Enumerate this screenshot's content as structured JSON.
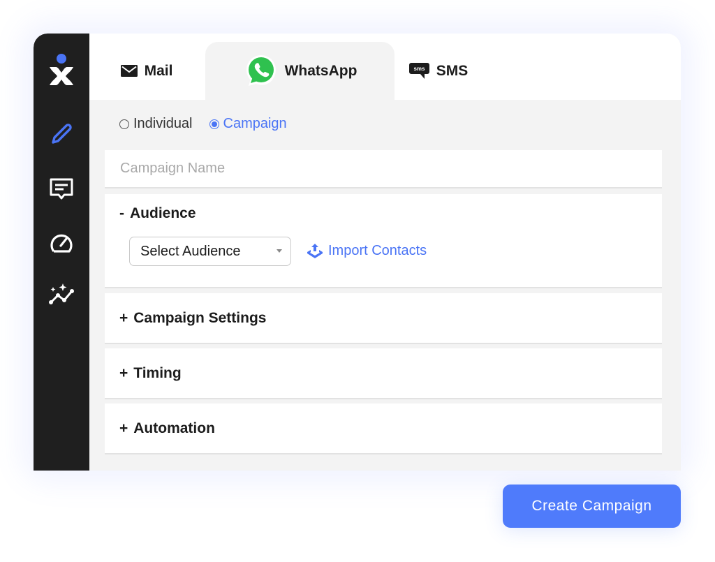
{
  "sidebar": {
    "items": [
      {
        "icon": "compose-icon",
        "active": true
      },
      {
        "icon": "message-icon"
      },
      {
        "icon": "speedometer-icon"
      },
      {
        "icon": "analytics-sparkle-icon"
      }
    ],
    "colors": {
      "active": "#4a74f5",
      "inactive": "#ffffff",
      "logo_dot": "#4a74f5"
    }
  },
  "tabs": [
    {
      "label": "Mail",
      "icon": "mail-icon",
      "active": false
    },
    {
      "label": "WhatsApp",
      "icon": "whatsapp-icon",
      "active": true
    },
    {
      "label": "SMS",
      "icon": "sms-icon",
      "active": false
    }
  ],
  "mode": {
    "options": [
      {
        "label": "Individual",
        "checked": false
      },
      {
        "label": "Campaign",
        "checked": true
      }
    ]
  },
  "form": {
    "campaign_name_placeholder": "Campaign Name",
    "campaign_name_value": "",
    "audience": {
      "toggle": "-",
      "title": "Audience",
      "select_value": "Select Audience",
      "import_label": "Import Contacts"
    },
    "sections": [
      {
        "toggle": "+",
        "title": "Campaign Settings"
      },
      {
        "toggle": "+",
        "title": "Timing"
      },
      {
        "toggle": "+",
        "title": "Automation"
      }
    ]
  },
  "actions": {
    "create_label": "Create Campaign"
  },
  "colors": {
    "accent": "#4f7bfb",
    "sidebar": "#1f1f1f",
    "whatsapp": "#25d366"
  }
}
